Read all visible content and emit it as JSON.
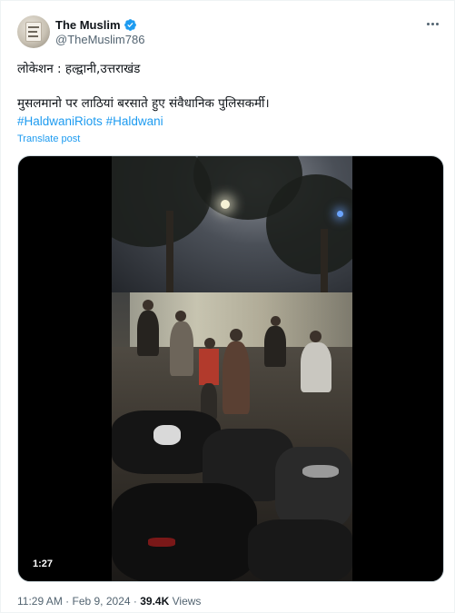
{
  "tweet": {
    "display_name": "The Muslim",
    "handle": "@TheMuslim786",
    "verified": true,
    "line1": "लोकेशन : हल्द्वानी,उत्तराखंड",
    "line2": "मुसलमानो पर लाठियां बरसाते हुए संवैधानिक पुलिसकर्मी।",
    "hashtags": [
      "#HaldwaniRiots",
      "#Haldwani"
    ],
    "translate_label": "Translate post",
    "video_duration": "1:27",
    "time": "11:29 AM",
    "separator": "·",
    "date": "Feb 9, 2024",
    "views_count": "39.4K",
    "views_label": "Views"
  },
  "colors": {
    "link": "#1d9bf0",
    "secondary_text": "#536471",
    "primary_text": "#0f1419",
    "verified_badge": "#1d9bf0"
  },
  "icons": {
    "verified": "verified-badge-icon",
    "more": "more-options-icon"
  }
}
